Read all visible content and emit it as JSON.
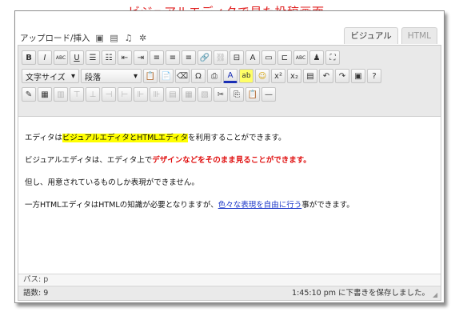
{
  "caption": "ビジュアルエディタで見た投稿画面",
  "media": {
    "label": "アップロード/挿入",
    "icons": [
      "image-icon",
      "video-icon",
      "audio-icon",
      "media-icon"
    ]
  },
  "tabs": [
    {
      "label": "ビジュアル",
      "active": true
    },
    {
      "label": "HTML",
      "active": false
    }
  ],
  "toolbar": {
    "row1": [
      {
        "name": "bold-button",
        "glyph": "B"
      },
      {
        "name": "italic-button",
        "glyph": "I"
      },
      {
        "name": "strikethrough-button",
        "glyph": "ABC"
      },
      {
        "name": "underline-button",
        "glyph": "U"
      },
      {
        "name": "bullet-list-button",
        "glyph": "☰"
      },
      {
        "name": "numbered-list-button",
        "glyph": "☷"
      },
      {
        "name": "outdent-button",
        "glyph": "⇤"
      },
      {
        "name": "indent-button",
        "glyph": "⇥"
      },
      {
        "name": "align-left-button",
        "glyph": "≡"
      },
      {
        "name": "align-center-button",
        "glyph": "≡"
      },
      {
        "name": "align-right-button",
        "glyph": "≡"
      },
      {
        "name": "insert-link-button",
        "glyph": "🔗"
      },
      {
        "name": "unlink-button",
        "glyph": "⛓"
      },
      {
        "name": "more-tag-button",
        "glyph": "⊟"
      },
      {
        "name": "underline-color-button",
        "glyph": "A"
      },
      {
        "name": "page-break-button",
        "glyph": "▭"
      },
      {
        "name": "insert-line-button",
        "glyph": "⊏"
      },
      {
        "name": "spellcheck-button",
        "glyph": "ABC"
      },
      {
        "name": "find-button",
        "glyph": "♟"
      },
      {
        "name": "fullscreen-button",
        "glyph": "⛶"
      }
    ],
    "format_select": {
      "label": "文字サイズ"
    },
    "paragraph_select": {
      "label": "段落"
    },
    "row2": [
      {
        "name": "paste-text-button",
        "glyph": "📋"
      },
      {
        "name": "paste-word-button",
        "glyph": "📄"
      },
      {
        "name": "clear-format-button",
        "glyph": "⌫"
      },
      {
        "name": "special-char-button",
        "glyph": "Ω"
      },
      {
        "name": "print-button",
        "glyph": "⎙"
      },
      {
        "name": "text-color-button",
        "glyph": "A"
      },
      {
        "name": "highlight-color-button",
        "glyph": "ab"
      },
      {
        "name": "emoticon-button",
        "glyph": "☺"
      },
      {
        "name": "superscript-button",
        "glyph": "x²"
      },
      {
        "name": "subscript-button",
        "glyph": "x₂"
      },
      {
        "name": "list-style-button",
        "glyph": "▤"
      },
      {
        "name": "undo-button",
        "glyph": "↶"
      },
      {
        "name": "redo-button",
        "glyph": "↷"
      },
      {
        "name": "insert-media-button",
        "glyph": "▣"
      },
      {
        "name": "help-button",
        "glyph": "?"
      }
    ],
    "row3": [
      {
        "name": "edit-css-button",
        "glyph": "✎"
      },
      {
        "name": "insert-table-button",
        "glyph": "▦"
      },
      {
        "name": "table-props-button",
        "glyph": "▥"
      },
      {
        "name": "row-before-button",
        "glyph": "⊤"
      },
      {
        "name": "row-after-button",
        "glyph": "⊥"
      },
      {
        "name": "delete-row-button",
        "glyph": "⊣"
      },
      {
        "name": "col-before-button",
        "glyph": "⊢"
      },
      {
        "name": "col-after-button",
        "glyph": "⊩"
      },
      {
        "name": "delete-col-button",
        "glyph": "⊪"
      },
      {
        "name": "split-cells-button",
        "glyph": "▤"
      },
      {
        "name": "merge-cells-button",
        "glyph": "▦"
      },
      {
        "name": "cell-props-button",
        "glyph": "▧"
      },
      {
        "name": "cut-button",
        "glyph": "✂"
      },
      {
        "name": "copy-button",
        "glyph": "⎘"
      },
      {
        "name": "paste-button",
        "glyph": "📋"
      },
      {
        "name": "horizontal-rule-button",
        "glyph": "—"
      }
    ]
  },
  "content": {
    "p1": {
      "before": "エディタは",
      "highlight": "ビジュアルエディタとHTMLエディタ",
      "after": "を利用することができます。"
    },
    "p2": {
      "before": "ビジュアルエディタは、エディタ上で",
      "red": "デザインなどをそのまま見ることができます。"
    },
    "p3": {
      "text": "但し、用意されているものしか表現ができません。"
    },
    "p4": {
      "before": "一方HTMLエディタはHTMLの知識が必要となりますが、",
      "link": "色々な表現を自由に行う",
      "after": "事ができます。"
    }
  },
  "path": {
    "label": "パス: p"
  },
  "status": {
    "word_count": "語数: 9",
    "saved": "1:45:10 pm に下書きを保存しました。"
  }
}
